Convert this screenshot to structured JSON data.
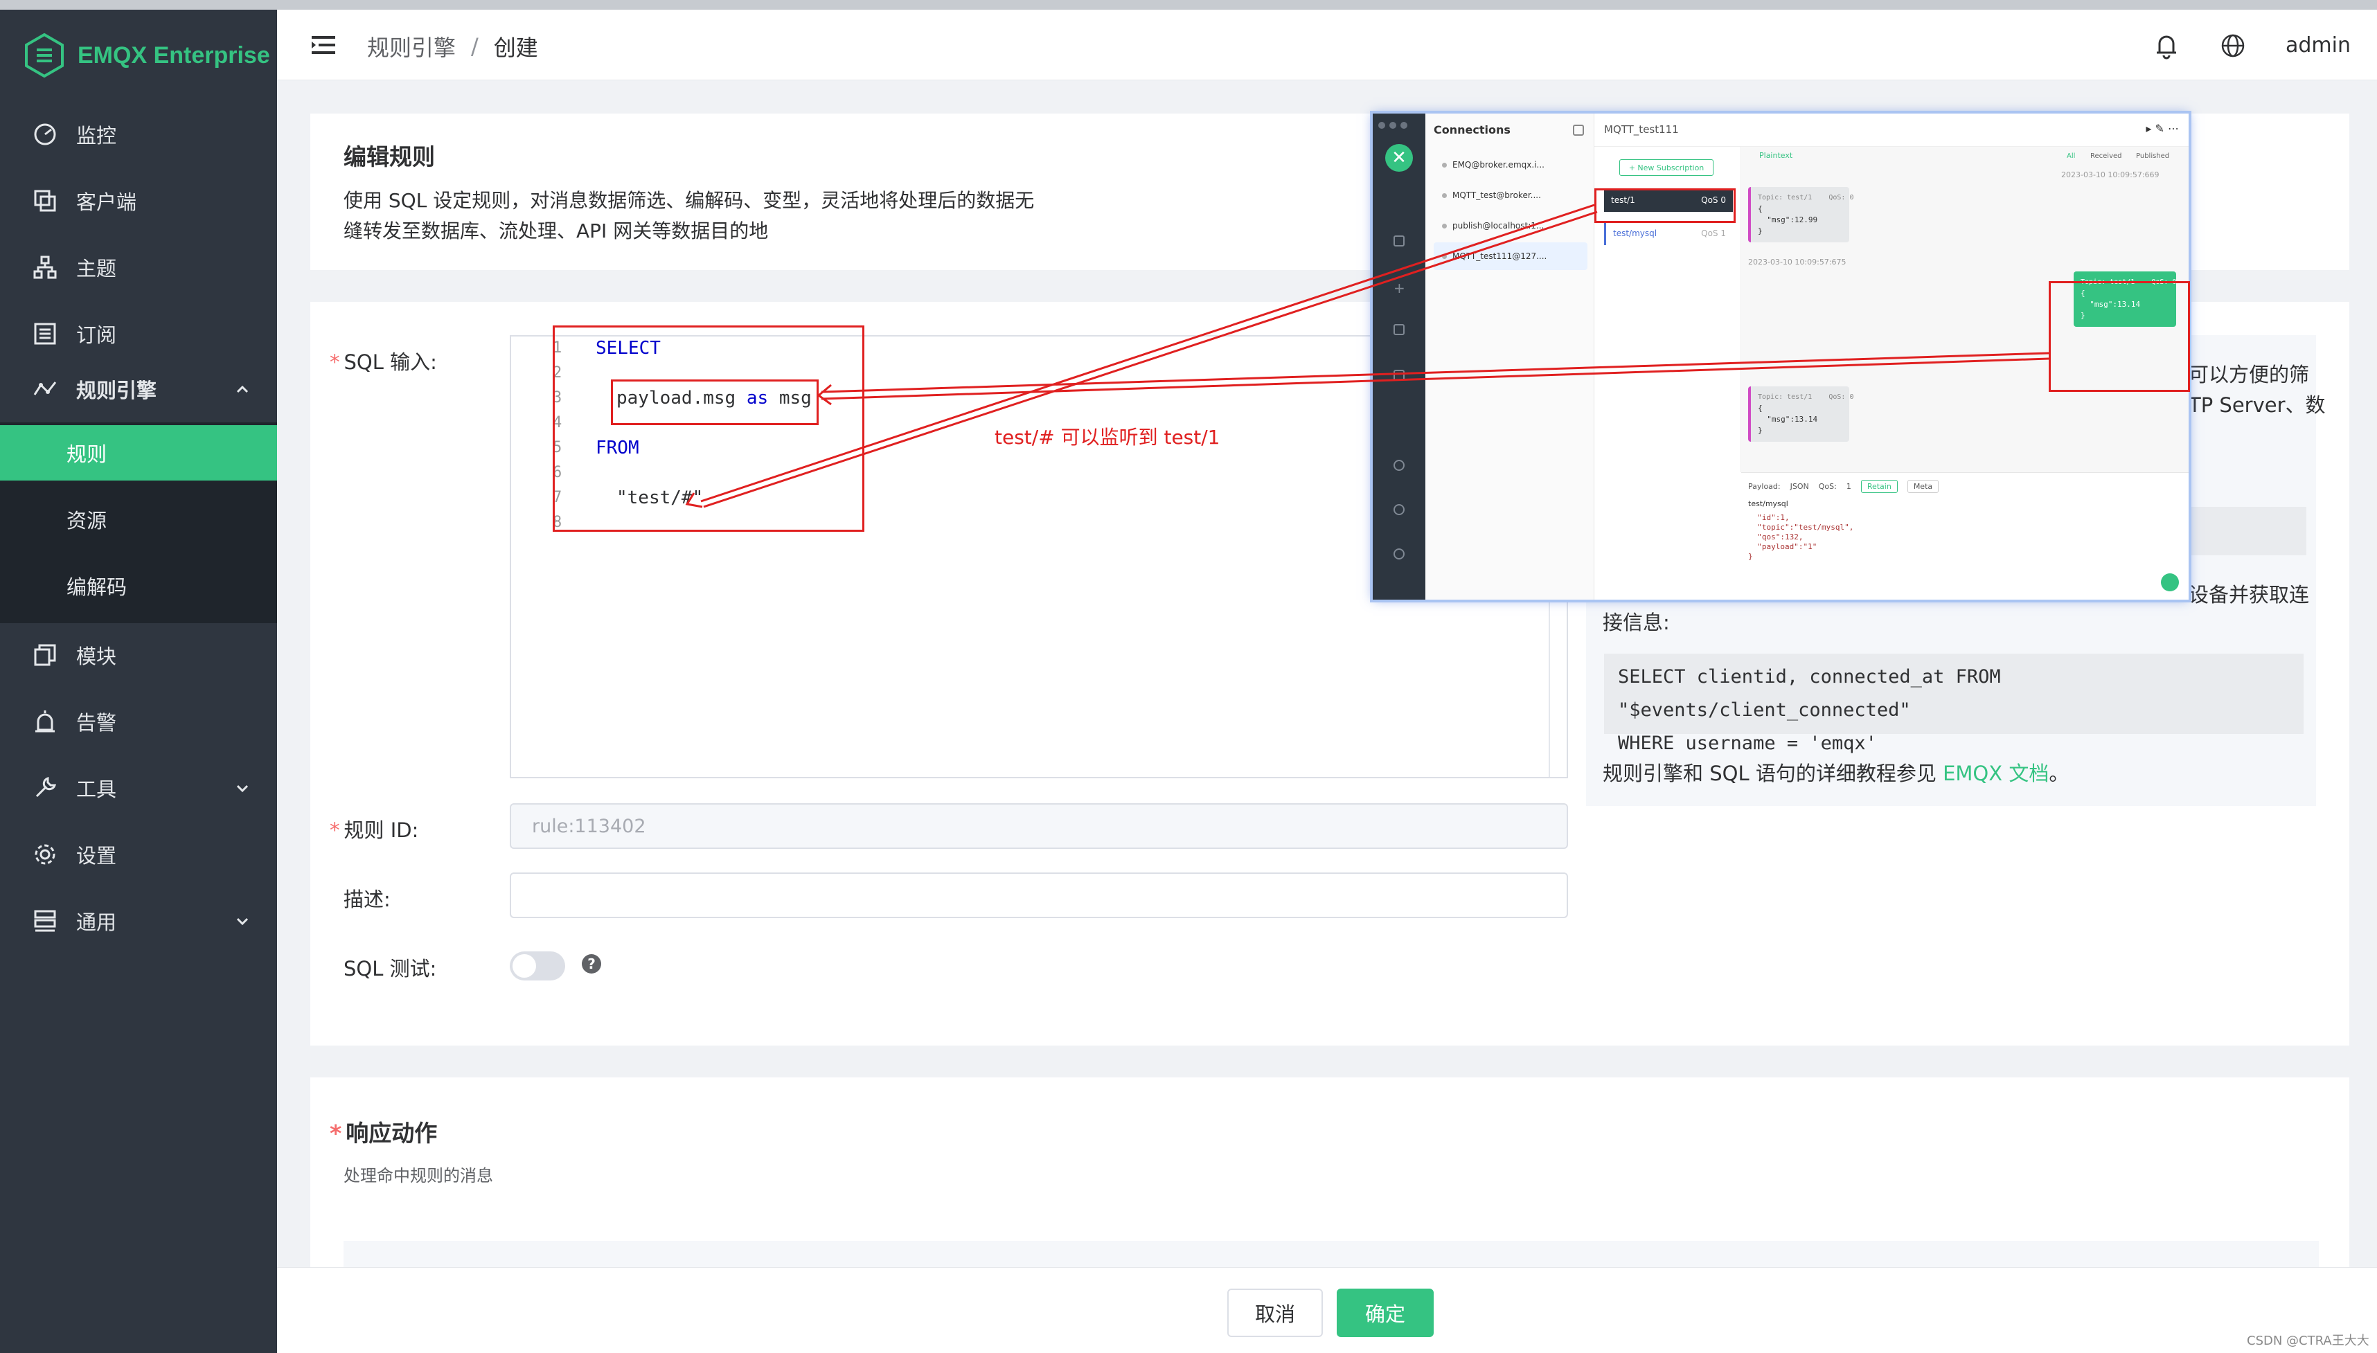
{
  "app": {
    "brand": "EMQX Enterprise",
    "accent_color": "#35c382",
    "sidebar_color": "#2f3640"
  },
  "sidebar": {
    "items": [
      {
        "label": "监控",
        "icon": "dashboard-icon"
      },
      {
        "label": "客户端",
        "icon": "clients-icon"
      },
      {
        "label": "主题",
        "icon": "topics-icon"
      },
      {
        "label": "订阅",
        "icon": "subscriptions-icon"
      },
      {
        "label": "规则引擎",
        "icon": "rule-engine-icon"
      },
      {
        "label": "模块",
        "icon": "modules-icon"
      },
      {
        "label": "告警",
        "icon": "alarm-icon"
      },
      {
        "label": "工具",
        "icon": "tools-icon"
      },
      {
        "label": "设置",
        "icon": "settings-icon"
      },
      {
        "label": "通用",
        "icon": "general-icon"
      }
    ],
    "sub_items": [
      {
        "label": "规则",
        "active": true
      },
      {
        "label": "资源",
        "active": false
      },
      {
        "label": "编解码",
        "active": false
      }
    ]
  },
  "header": {
    "breadcrumb_parent": "规则引擎",
    "breadcrumb_sep": "/",
    "breadcrumb_current": "创建",
    "user": "admin"
  },
  "edit_card": {
    "title": "编辑规则",
    "desc_line1": "使用 SQL 设定规则，对消息数据筛选、编解码、变型，灵活地将处理后的数据无",
    "desc_line2": "缝转发至数据库、流处理、API 网关等数据目的地"
  },
  "form": {
    "sql_label": "SQL 输入:",
    "sql_lines": [
      {
        "num": "1",
        "text": "SELECT"
      },
      {
        "num": "2",
        "text": ""
      },
      {
        "num": "3",
        "text": "payload.msg as msg"
      },
      {
        "num": "4",
        "text": ""
      },
      {
        "num": "5",
        "text": "FROM"
      },
      {
        "num": "6",
        "text": ""
      },
      {
        "num": "7",
        "text": "\"test/#\""
      },
      {
        "num": "8",
        "text": ""
      }
    ],
    "sql_kw_as": "as",
    "sql_field": "payload.msg",
    "sql_alias": "msg",
    "rule_id_label": "规则 ID:",
    "rule_id_placeholder": "rule:113402",
    "desc_label": "描述:",
    "desc_value": "",
    "sql_test_label": "SQL 测试:",
    "sql_test_enabled": false,
    "help_mark": "?"
  },
  "help": {
    "frag1": "可以方便的筛",
    "frag2": "TP Server、数",
    "frag3": "设备并获取连",
    "line_conn": "接信息:",
    "code_line1": "SELECT clientid, connected_at FROM \"$events/client_connected\"",
    "code_line2": "WHERE username = 'emqx'",
    "footer_text": "规则引擎和 SQL 语句的详细教程参见",
    "footer_link": "EMQX 文档",
    "footer_end": "。"
  },
  "annotation": {
    "note": "test/# 可以监听到 test/1",
    "color": "#e02020"
  },
  "mqttx": {
    "connections_title": "Connections",
    "connections": [
      "EMQ@broker.emqx.i...",
      "MQTT_test@broker....",
      "publish@localhost:1...",
      "MQTT_test111@127...."
    ],
    "active_connection": "MQTT_test111",
    "new_subscription": "+ New Subscription",
    "subscriptions": [
      {
        "topic": "test/1",
        "qos": "QoS 0"
      },
      {
        "topic": "test/mysql",
        "qos": "QoS 1"
      }
    ],
    "format": "Plaintext",
    "filters": [
      "All",
      "Received",
      "Published"
    ],
    "messages": [
      {
        "kind": "received",
        "header": "Topic: test/1    QoS: 0",
        "body": "{\n  \"msg\":12.99\n}",
        "time": "2023-03-10 10:09:57:675"
      },
      {
        "kind": "sent",
        "header": "Topic: test/1    QoS: 0",
        "body": "{\n  \"msg\":13.14\n}",
        "time": "2023-03-10 10:09:57:669"
      },
      {
        "kind": "received",
        "header": "Topic: test/1    QoS: 0",
        "body": "{\n  \"msg\":13.14\n}",
        "time": ""
      }
    ],
    "payload_label": "Payload:",
    "payload_format": "JSON",
    "qos_label": "QoS:",
    "qos_value": "1",
    "retain": "Retain",
    "meta": "Meta",
    "publish_topic": "test/mysql",
    "payload_text": "  \"id\":1,\n  \"topic\":\"test/mysql\",\n  \"qos\":132,\n  \"payload\":\"1\"\n}"
  },
  "actions_card": {
    "title": "响应动作",
    "desc": "处理命中规则的消息"
  },
  "footer": {
    "cancel": "取消",
    "ok": "确定"
  },
  "watermark": "CSDN @CTRA王大大"
}
